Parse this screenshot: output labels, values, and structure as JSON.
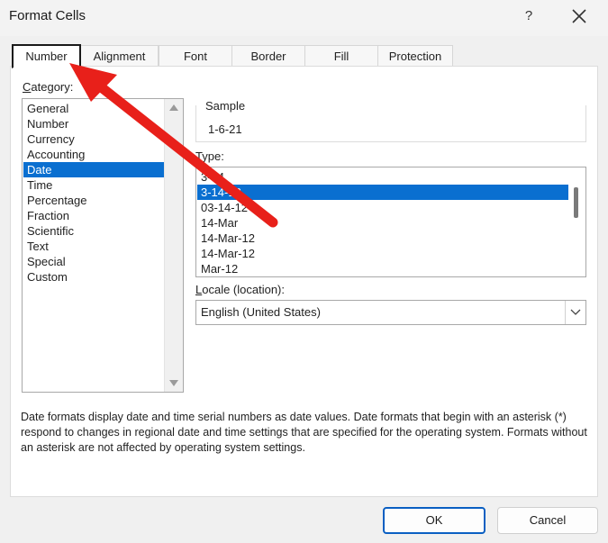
{
  "window": {
    "title": "Format Cells",
    "help_label": "?"
  },
  "tabs": [
    {
      "label": "Number"
    },
    {
      "label": "Alignment"
    },
    {
      "label": "Font"
    },
    {
      "label": "Border"
    },
    {
      "label": "Fill"
    },
    {
      "label": "Protection"
    }
  ],
  "category": {
    "label_underlined": "C",
    "label_rest": "ategory:",
    "items": [
      "General",
      "Number",
      "Currency",
      "Accounting",
      "Date",
      "Time",
      "Percentage",
      "Fraction",
      "Scientific",
      "Text",
      "Special",
      "Custom"
    ],
    "selected": "Date"
  },
  "sample": {
    "label": "Sample",
    "value": "1-6-21"
  },
  "type": {
    "label_underlined": "T",
    "label_rest": "ype:",
    "items": [
      "3-14",
      "3-14-12",
      "03-14-12",
      "14-Mar",
      "14-Mar-12",
      "14-Mar-12",
      "Mar-12"
    ],
    "selected": "3-14-12"
  },
  "locale": {
    "label_underlined": "L",
    "label_rest": "ocale (location):",
    "value": "English (United States)"
  },
  "description": "Date formats display date and time serial numbers as date values.  Date formats that begin with an asterisk (*) respond to changes in regional date and time settings that are specified for the operating system. Formats without an asterisk are not affected by operating system settings.",
  "buttons": {
    "ok": "OK",
    "cancel": "Cancel"
  },
  "colors": {
    "selection": "#0a6fd0",
    "annotation_arrow": "#e8201a"
  }
}
